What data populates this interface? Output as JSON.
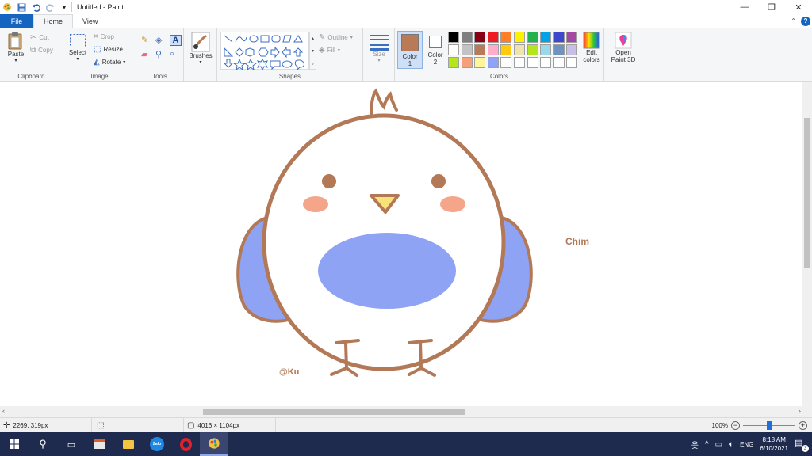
{
  "window": {
    "title": "Untitled - Paint",
    "controls": {
      "minimize": "—",
      "maximize": "❐",
      "close": "✕"
    }
  },
  "tabs": [
    {
      "label": "File"
    },
    {
      "label": "Home"
    },
    {
      "label": "View"
    }
  ],
  "ribbon": {
    "clipboard": {
      "group_label": "Clipboard",
      "paste": "Paste",
      "cut": "Cut",
      "copy": "Copy"
    },
    "image": {
      "group_label": "Image",
      "select": "Select",
      "crop": "Crop",
      "resize": "Resize",
      "rotate": "Rotate"
    },
    "tools": {
      "group_label": "Tools"
    },
    "brushes": {
      "label": "Brushes"
    },
    "shapes": {
      "group_label": "Shapes",
      "outline": "Outline",
      "fill": "Fill"
    },
    "size": {
      "label": "Size"
    },
    "colors": {
      "group_label": "Colors",
      "color1_label": "Color",
      "color1_num": "1",
      "color2_label": "Color",
      "color2_num": "2",
      "color1_value": "#b97a57",
      "color2_value": "#ffffff",
      "edit_colors": "Edit colors",
      "open_paint3d": "Open Paint 3D",
      "palette_row1": [
        "#000000",
        "#7f7f7f",
        "#880015",
        "#ed1c24",
        "#ff7f27",
        "#fff200",
        "#22b14c",
        "#00a2e8",
        "#3f48cc",
        "#a349a4"
      ],
      "palette_row2": [
        "#ffffff",
        "#c3c3c3",
        "#b97a57",
        "#ffaec9",
        "#ffc90e",
        "#efe4b0",
        "#b5e61d",
        "#99d9ea",
        "#7092be",
        "#c8bfe7"
      ],
      "palette_row3": [
        "#b5e61d",
        "#f4a07a",
        "#fff59a",
        "#8fa3f5",
        "#ffffff",
        "#ffffff",
        "#ffffff",
        "#ffffff",
        "#ffffff",
        "#ffffff"
      ]
    }
  },
  "canvas": {
    "label_chim": "Chim",
    "label_signature": "@Ku",
    "colors": {
      "outline": "#b37855",
      "blue": "#8fa3f5",
      "cheek": "#f5a58a",
      "beak": "#f7e37a"
    }
  },
  "status": {
    "cursor_pos": "2269, 319px",
    "image_size": "4016 × 1104px",
    "zoom": "100%",
    "zoom_level_percent": 100
  },
  "taskbar": {
    "language": "ENG",
    "time": "8:18 AM",
    "date": "6/10/2021",
    "notification_count": "3",
    "zalo_label": "Zalo"
  }
}
